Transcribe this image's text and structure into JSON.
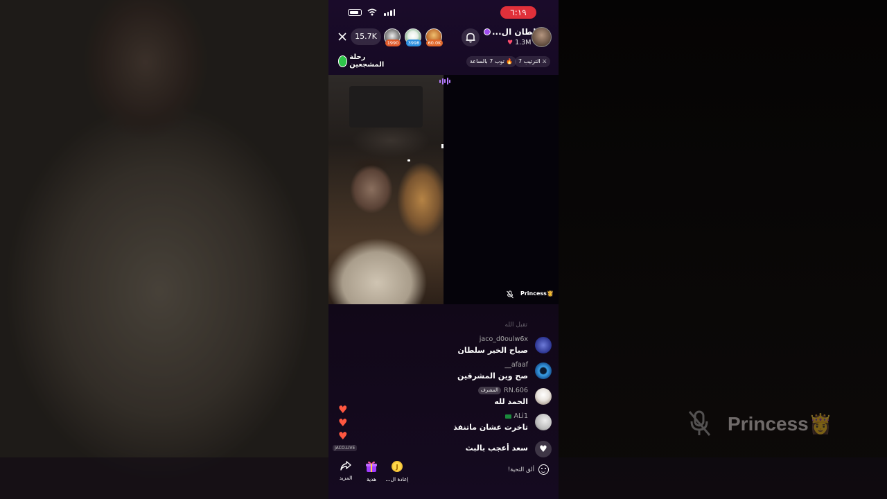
{
  "status": {
    "time": "٦:١٩"
  },
  "header": {
    "viewer_count": "15.7K",
    "top_viewers": [
      {
        "badge": "1990",
        "badge_color": "#e05a2b"
      },
      {
        "badge": "3998",
        "badge_color": "#2b8fe0"
      },
      {
        "badge": "60.0K",
        "badge_color": "#e0682b"
      }
    ],
    "host_name": "سلطان ال...",
    "host_likes": "1.3M"
  },
  "subheader": {
    "journey_label": "رحلة المشجعين",
    "rank_chip": "الترتيب 7",
    "top_chip": "توب 7 بالساعة"
  },
  "stream": {
    "guest_name": "Princess👸"
  },
  "comments": {
    "faded": "تقبل الله",
    "items": [
      {
        "user": "jaco_d0oulw6x",
        "message": "صباح الخير سلطان",
        "avatar_color": "#3c4aa8"
      },
      {
        "user": "afaaf__",
        "message": "صح وين المشرقين",
        "avatar_color": "#2a7ac0"
      },
      {
        "user": "RN.606",
        "badge": "المشرف",
        "message": "الحمد لله",
        "avatar_color": "#e9e4de"
      },
      {
        "user": "ALi1",
        "message": "تاخرت عشان ماتنفذ",
        "avatar_color": "#cfcfcf"
      },
      {
        "user": "",
        "message": "سعد أعجب بالبث",
        "avatar_color": "#ffffff"
      }
    ]
  },
  "side": {
    "brand": "JACO.LIVE"
  },
  "bottom_bar": {
    "more": "المزيد",
    "gift": "هدية",
    "replay": "إعادة ال...",
    "say_hi_placeholder": "ألق التحية!"
  },
  "mirror": {
    "guest_name": "Princess👸"
  }
}
